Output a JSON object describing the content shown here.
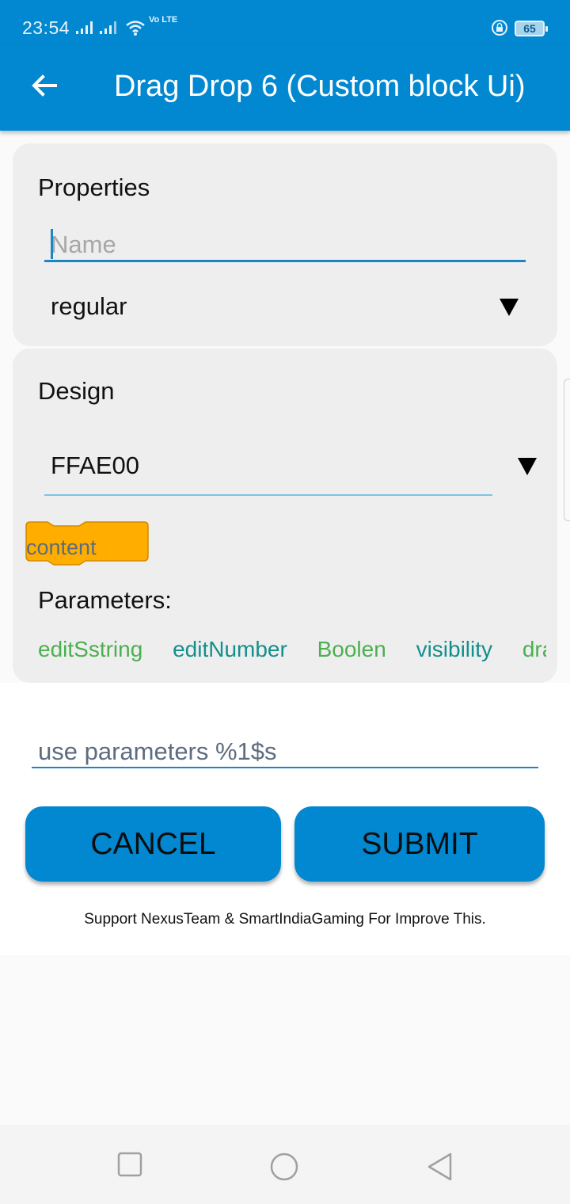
{
  "status_bar": {
    "time": "23:54",
    "network": "Vo LTE",
    "battery": "65"
  },
  "app_bar": {
    "title": "Drag Drop 6 (Custom block Ui)",
    "back_icon": "arrow-left-icon"
  },
  "properties": {
    "title": "Properties",
    "name_placeholder": "Name",
    "name_value": "",
    "type_selected": "regular"
  },
  "design": {
    "title": "Design",
    "color_selected": "FFAE00",
    "block_preview_label": "content",
    "block_color": "#FFAE00",
    "parameters_label": "Parameters:",
    "parameters": [
      {
        "label": "editSstring",
        "color": "#4caf50"
      },
      {
        "label": "editNumber",
        "color": "#138f8c"
      },
      {
        "label": "Boolen",
        "color": "#4caf50"
      },
      {
        "label": "visibility",
        "color": "#138f8c"
      },
      {
        "label": "draw",
        "color": "#4caf50"
      }
    ]
  },
  "spec_input": {
    "value": "use parameters %1$s"
  },
  "buttons": {
    "cancel": "CANCEL",
    "submit": "SUBMIT"
  },
  "footer": {
    "note": "Support NexusTeam & SmartIndiaGaming For Improve This."
  },
  "nav": {
    "recents": "square-icon",
    "home": "circle-icon",
    "back": "triangle-back-icon"
  },
  "colors": {
    "primary": "#0288d1",
    "card_bg": "#eeeeee",
    "accent": "#1a86c2"
  }
}
